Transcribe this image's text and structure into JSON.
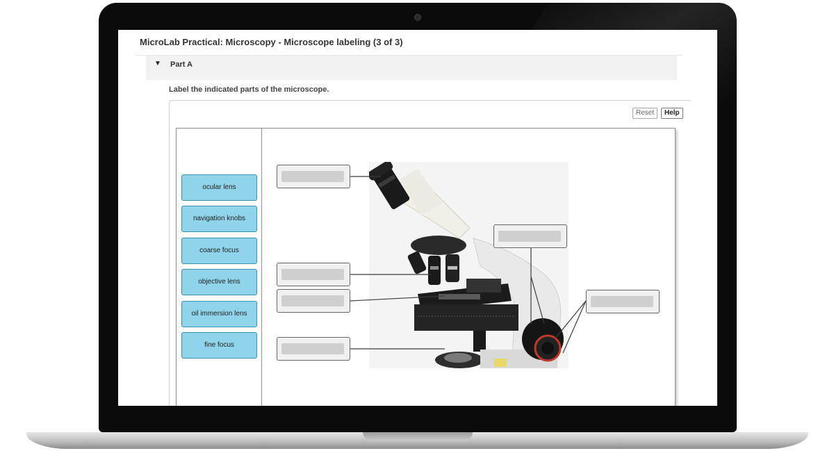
{
  "page": {
    "title": "MicroLab Practical: Microscopy - Microscope labeling (3 of 3)"
  },
  "part": {
    "label": "Part A",
    "toggle_icon": "caret-down-icon"
  },
  "instruction": "Label the indicated parts of the microscope.",
  "toolbar": {
    "reset_label": "Reset",
    "help_label": "Help"
  },
  "label_bank": [
    "ocular lens",
    "navigation knobs",
    "coarse focus",
    "objective lens",
    "oil immersion lens",
    "fine focus"
  ],
  "drop_targets_count": 6,
  "colors": {
    "chip_fill": "#8fd4ea",
    "chip_border": "#3a8fb0",
    "target_fill": "#f0f0f0",
    "target_slot": "#cfcfcf"
  }
}
